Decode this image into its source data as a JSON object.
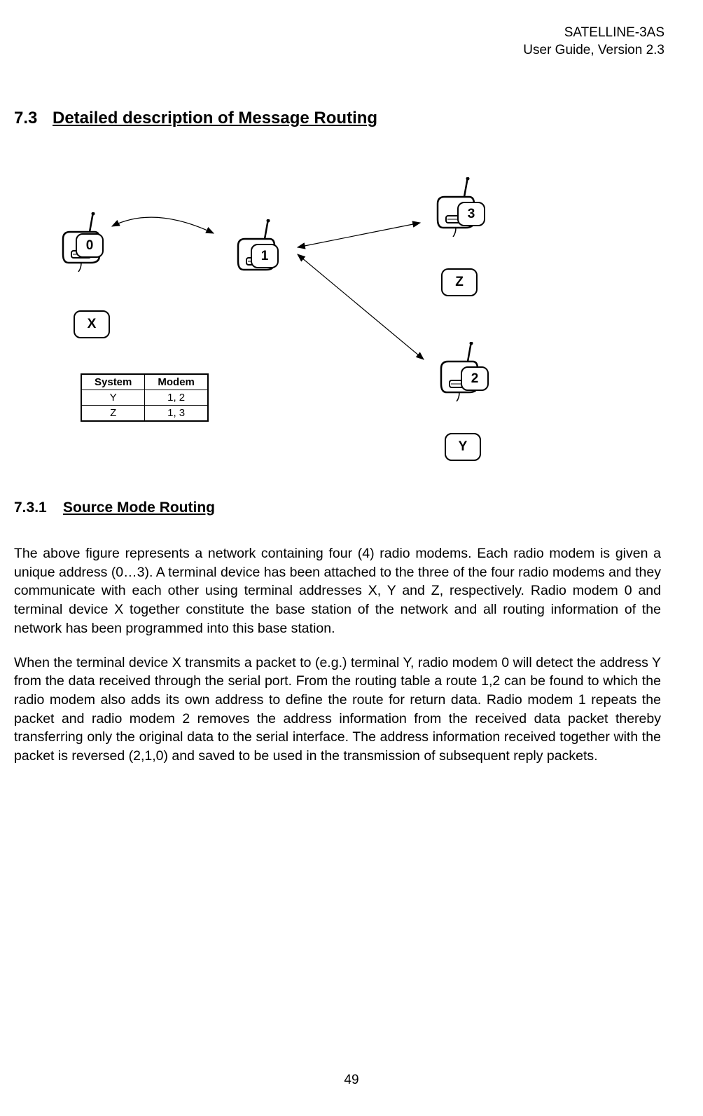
{
  "header": {
    "product": "SATELLINE-3AS",
    "guide": "User Guide, Version 2.3"
  },
  "section": {
    "number": "7.3",
    "title": "Detailed description of Message Routing"
  },
  "diagram": {
    "modems": {
      "m0": {
        "id": "0",
        "terminal": "X"
      },
      "m1": {
        "id": "1"
      },
      "m2": {
        "id": "2",
        "terminal": "Y"
      },
      "m3": {
        "id": "3",
        "terminal": "Z"
      }
    },
    "routing_table": {
      "headers": {
        "col1": "System",
        "col2": "Modem"
      },
      "rows": {
        "r1": {
          "system": "Y",
          "modem": "1, 2"
        },
        "r2": {
          "system": "Z",
          "modem": "1, 3"
        }
      }
    }
  },
  "subsection": {
    "number": "7.3.1",
    "title": "Source Mode Routing"
  },
  "paragraphs": {
    "p1": "The above figure represents a network containing four (4) radio modems. Each radio modem is given a unique address (0…3). A terminal device has been attached to the three of the four radio modems and they communicate with each other using terminal addresses X, Y and Z, respectively. Radio modem 0 and terminal device X together constitute the base station of the network and all routing information of the network has been programmed into this base station.",
    "p2": "When the terminal device X transmits a packet to (e.g.) terminal Y, radio modem 0 will detect the address Y from the data received through the serial port. From the routing table a route 1,2 can be found to which the radio modem also adds its own address to define the route for return data. Radio modem 1 repeats the packet and radio modem 2 removes the address information from the received data packet thereby transferring only the original data to the serial interface. The address information received together with the packet is reversed (2,1,0) and saved to be used in the transmission of subsequent reply packets."
  },
  "page_number": "49"
}
